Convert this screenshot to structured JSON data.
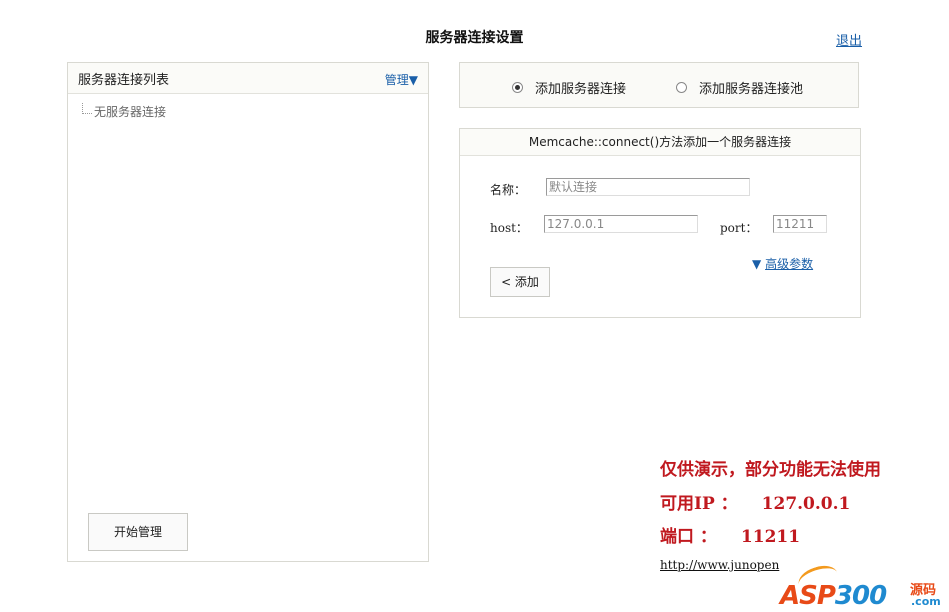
{
  "header": {
    "title": "服务器连接设置",
    "logout_label": "退出"
  },
  "left_panel": {
    "title": "服务器连接列表",
    "manage_label": "管理▼",
    "tree_empty": "无服务器连接",
    "start_button": "开始管理"
  },
  "mode": {
    "options": [
      {
        "label": "添加服务器连接",
        "selected": true
      },
      {
        "label": "添加服务器连接池",
        "selected": false
      }
    ]
  },
  "form": {
    "heading": "Memcache::connect()方法添加一个服务器连接",
    "name_label": "名称：",
    "name_value": "默认连接",
    "host_label": "host：",
    "host_value": "127.0.0.1",
    "port_label": "port：",
    "port_value": "11211",
    "advanced_arrow": "▼",
    "advanced_label": "高级参数",
    "add_button": "< 添加"
  },
  "notice": {
    "line1": "仅供演示，部分功能无法使用",
    "ip_label": "可用IP ：",
    "ip_value": "127.0.0.1",
    "port_label": "端口 ：",
    "port_value": "11211",
    "link": "http://www.junopen"
  },
  "watermark": {
    "brand_a": "ASP",
    "brand_b": "300",
    "suffix_cn": "源码",
    "suffix_com": ".com"
  },
  "colors": {
    "link": "#1a5fa8",
    "notice": "#c0191f",
    "border": "#d9d9d2"
  }
}
